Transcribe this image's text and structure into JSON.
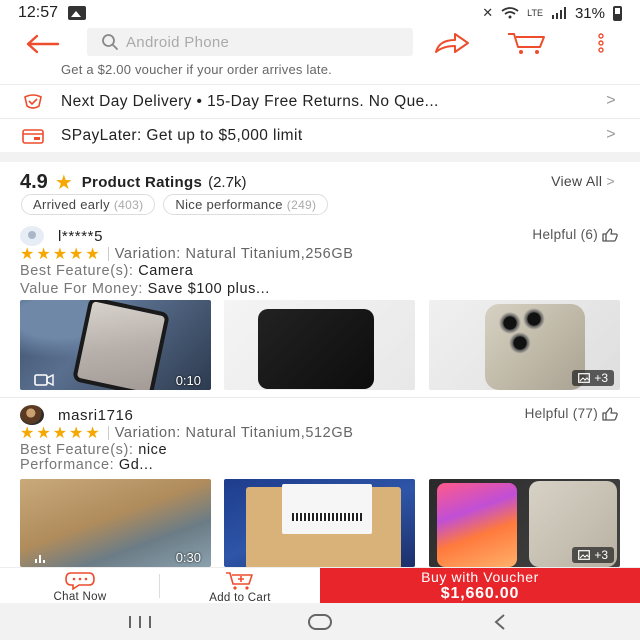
{
  "status_bar": {
    "time": "12:57",
    "battery": "31%",
    "network": "LTE"
  },
  "search": {
    "placeholder": "Android Phone"
  },
  "voucher_note": "Get a $2.00 voucher if your order arrives late.",
  "info_rows": [
    {
      "text": "Next Day Delivery  •  15-Day Free Returns. No Que..."
    },
    {
      "text": "SPayLater: Get up to $5,000 limit"
    }
  ],
  "ratings": {
    "score": "4.9",
    "title": "Product Ratings",
    "count": "(2.7k)",
    "view_all": "View All",
    "chips": [
      {
        "label": "Arrived early",
        "count": "(403)"
      },
      {
        "label": "Nice performance",
        "count": "(249)"
      }
    ]
  },
  "reviews": [
    {
      "name": "l*****5",
      "helpful": "Helpful (6)",
      "stars": "★★★★★",
      "variation": "Variation: Natural Titanium,256GB",
      "attr1_key": "Best Feature(s): ",
      "attr1_val": "Camera",
      "attr2_key": "Value For Money: ",
      "attr2_val": "Save $100 plus...",
      "video_duration": "0:10",
      "more_count": "+3"
    },
    {
      "name": "masri1716",
      "helpful": "Helpful (77)",
      "stars": "★★★★★",
      "variation": "Variation: Natural Titanium,512GB",
      "attr1_key": "Best Feature(s): ",
      "attr1_val": "nice",
      "attr2_key": "Performance: ",
      "attr2_val": "Gd...",
      "video_duration": "0:30",
      "more_count": "+3"
    }
  ],
  "bottom_bar": {
    "chat_label": "Chat Now",
    "cart_label": "Add to Cart",
    "buy_title": "Buy with Voucher",
    "buy_price": "$1,660.00"
  },
  "colors": {
    "accent": "#ee4d2d",
    "buy": "#e7252a",
    "star": "#f6a700"
  },
  "icons": [
    "back-arrow-icon",
    "search-icon",
    "share-icon",
    "cart-icon",
    "more-icon",
    "truck-icon",
    "spaylater-icon",
    "star-icon",
    "thumbs-up-icon",
    "video-icon",
    "image-icon",
    "chat-icon",
    "add-cart-icon"
  ]
}
